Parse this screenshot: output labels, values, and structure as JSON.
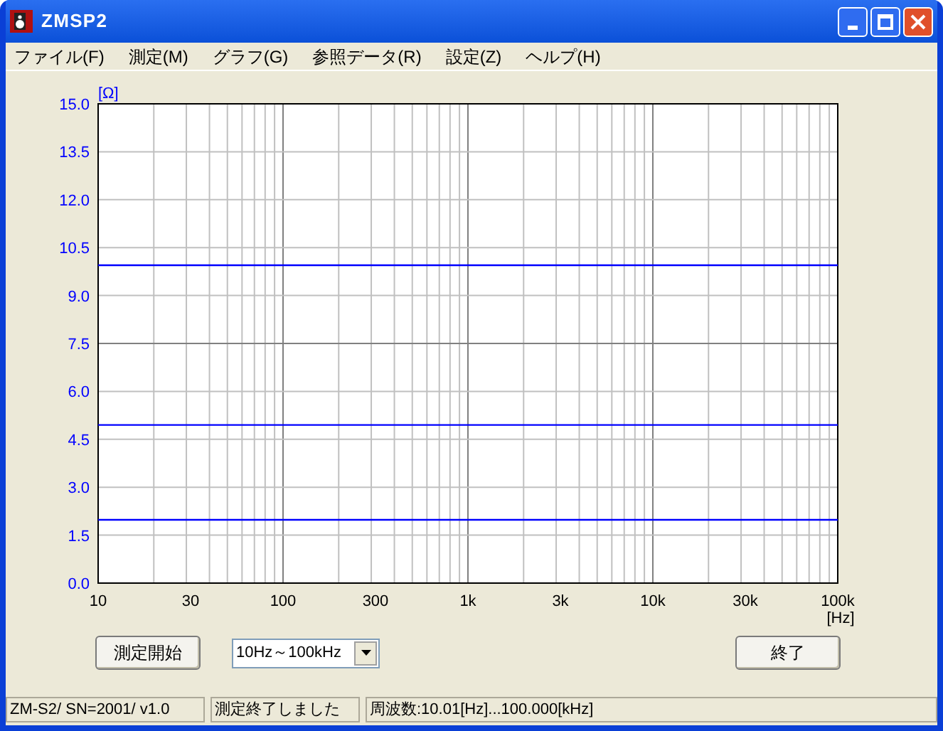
{
  "window": {
    "title": "ZMSP2"
  },
  "menu": [
    {
      "label": "ファイル(F)"
    },
    {
      "label": "測定(M)"
    },
    {
      "label": "グラフ(G)"
    },
    {
      "label": "参照データ(R)"
    },
    {
      "label": "設定(Z)"
    },
    {
      "label": "ヘルプ(H)"
    }
  ],
  "chart": {
    "chart_data": {
      "type": "line",
      "xlabel": "[Hz]",
      "ylabel": "[Ω]",
      "categories": [
        "10",
        "30",
        "100",
        "300",
        "1k",
        "3k",
        "10k",
        "30k",
        "100k"
      ],
      "series": [
        {
          "color": "#0000ff",
          "values": [
            9.95,
            9.95,
            9.95,
            9.95,
            9.95,
            9.95,
            9.95,
            9.95,
            9.95
          ]
        },
        {
          "color": "#0000ff",
          "values": [
            4.95,
            4.95,
            4.95,
            4.95,
            4.95,
            4.95,
            4.95,
            4.95,
            4.95
          ]
        },
        {
          "color": "#0000ff",
          "values": [
            1.98,
            1.98,
            1.98,
            1.98,
            1.98,
            1.98,
            1.98,
            1.98,
            1.98
          ]
        }
      ],
      "ylim": [
        0,
        15
      ],
      "grid": true,
      "yticks": [
        {
          "value": 0,
          "label": "0.0"
        },
        {
          "value": 1.5,
          "label": "1.5"
        },
        {
          "value": 3,
          "label": "3.0"
        },
        {
          "value": 4.5,
          "label": "4.5"
        },
        {
          "value": 6,
          "label": "6.0"
        },
        {
          "value": 7.5,
          "label": "7.5"
        },
        {
          "value": 9,
          "label": "9.0"
        },
        {
          "value": 10.5,
          "label": "10.5"
        },
        {
          "value": 12,
          "label": "12.0"
        },
        {
          "value": 13.5,
          "label": "13.5"
        },
        {
          "value": 15,
          "label": "15.0"
        }
      ]
    }
  },
  "start_button": {
    "label": "測定開始"
  },
  "range_dropdown": {
    "value": "10Hz～100kHz"
  },
  "exit_button": {
    "label": "終了"
  },
  "status_bar": [
    "ZM-S2/ SN=2001/ v1.0",
    "測定終了しました",
    "周波数:10.01[Hz]...100.000[kHz]"
  ]
}
